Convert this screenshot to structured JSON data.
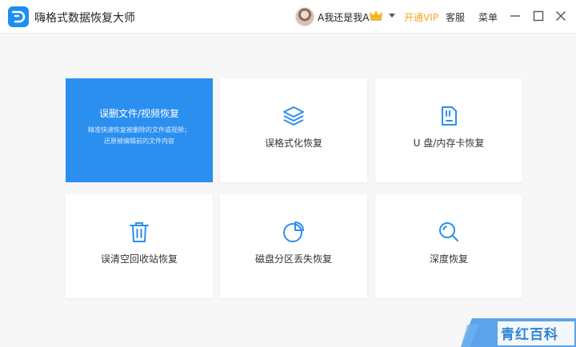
{
  "app": {
    "title": "嗨格式数据恢复大师",
    "logo_icon": "app-logo-icon"
  },
  "header": {
    "username": "A我还是我A",
    "vip_label": "开通VIP",
    "service_label": "客服",
    "menu_label": "菜单"
  },
  "colors": {
    "accent": "#2b8ff0",
    "vip": "#f5a623",
    "background": "#f7f7f7"
  },
  "cards": [
    {
      "title": "误删文件/视频恢复",
      "desc_line1": "精准快速恢复被删除的文件或视频；",
      "desc_line2": "还原被编辑前的文件内容",
      "selected": true
    },
    {
      "label": "误格式化恢复",
      "icon": "layers-icon"
    },
    {
      "label": "U 盘/内存卡恢复",
      "icon": "sd-card-icon"
    },
    {
      "label": "误清空回收站恢复",
      "icon": "trash-icon"
    },
    {
      "label": "磁盘分区丢失恢复",
      "icon": "pie-chart-icon"
    },
    {
      "label": "深度恢复",
      "icon": "search-icon"
    }
  ],
  "watermark": {
    "text": "青红百科"
  }
}
